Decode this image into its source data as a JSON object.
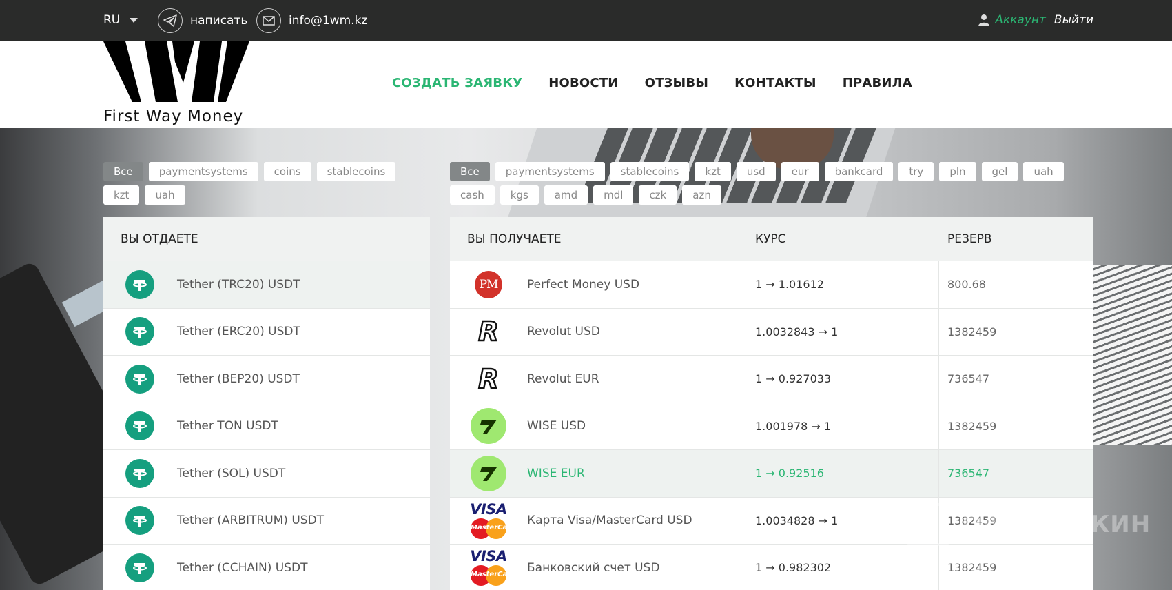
{
  "topbar": {
    "language": "RU",
    "telegram_label": "написать",
    "email_label": "info@1wm.kz",
    "account_label": "Аккаунт",
    "logout_label": "Выйти"
  },
  "header": {
    "logo_text": "First Way Money",
    "nav": [
      "СОЗДАТЬ ЗАЯВКУ",
      "НОВОСТИ",
      "ОТЗЫВЫ",
      "КОНТАКТЫ",
      "ПРАВИЛА"
    ]
  },
  "give_filters": [
    "Все",
    "paymentsystems",
    "coins",
    "stablecoins",
    "kzt",
    "uah"
  ],
  "get_filters": [
    "Все",
    "paymentsystems",
    "stablecoins",
    "kzt",
    "usd",
    "eur",
    "bankcard",
    "try",
    "pln",
    "gel",
    "uah",
    "cash",
    "kgs",
    "amd",
    "mdl",
    "czk",
    "azn"
  ],
  "give": {
    "heading": "ВЫ ОТДАЕТЕ",
    "items": [
      "Tether (TRC20) USDT",
      "Tether (ERC20) USDT",
      "Tether (BEP20) USDT",
      "Tether TON USDT",
      "Tether (SOL) USDT",
      "Tether (ARBITRUM) USDT",
      "Tether (CCHAIN) USDT"
    ]
  },
  "get": {
    "heading": "ВЫ ПОЛУЧАЕТЕ",
    "rate_heading": "КУРС",
    "reserve_heading": "РЕЗЕРВ",
    "rows": [
      {
        "name": "Perfect Money USD",
        "rate": "1 → 1.01612",
        "reserve": "800.68"
      },
      {
        "name": "Revolut USD",
        "rate": "1.0032843 → 1",
        "reserve": "1382459"
      },
      {
        "name": "Revolut EUR",
        "rate": "1 → 0.927033",
        "reserve": "736547"
      },
      {
        "name": "WISE USD",
        "rate": "1.001978 → 1",
        "reserve": "1382459"
      },
      {
        "name": "WISE EUR",
        "rate": "1 → 0.92516",
        "reserve": "736547"
      },
      {
        "name": "Карта Visa/MasterCard USD",
        "rate": "1.0034828 → 1",
        "reserve": "1382459"
      },
      {
        "name": "Банковский счет USD",
        "rate": "1 → 0.982302",
        "reserve": "1382459"
      }
    ]
  },
  "icons": {
    "pm_text": "PM",
    "revolut_text": "R",
    "visa_text": "VISA",
    "mastercard_text": "MasterCard"
  },
  "watermark": "ПАРТНЕРКИН",
  "colors": {
    "accent": "#2bb673",
    "topbar": "#2a2b2a",
    "tether": "#159f7f",
    "wise": "#9fe870"
  }
}
